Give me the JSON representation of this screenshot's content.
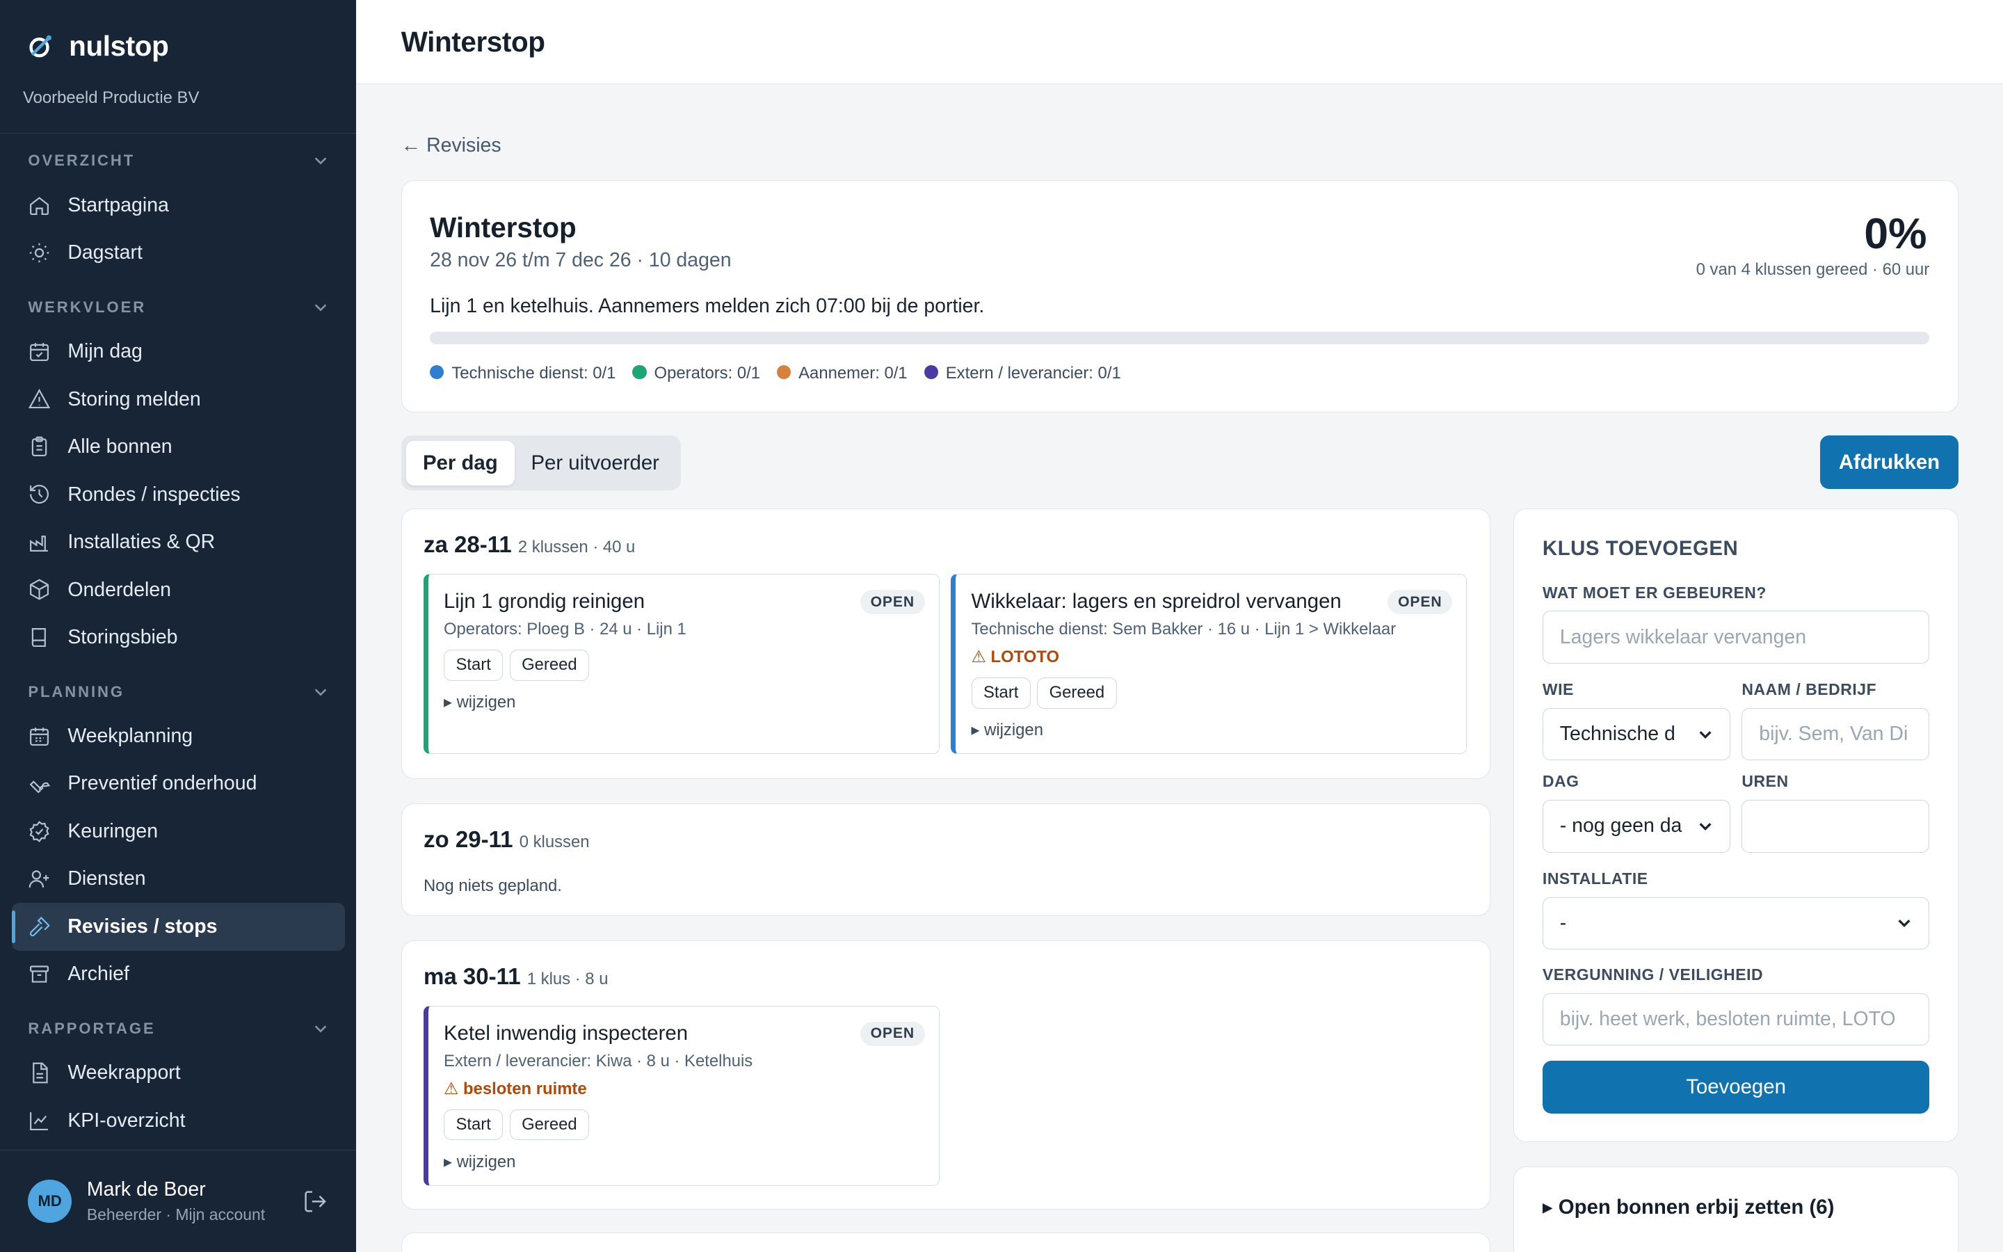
{
  "brand": {
    "name": "nulstop",
    "org": "Voorbeeld Productie BV"
  },
  "sidebar": {
    "sections": [
      {
        "title": "OVERZICHT",
        "items": [
          {
            "label": "Startpagina",
            "icon": "home-icon"
          },
          {
            "label": "Dagstart",
            "icon": "sun-icon"
          }
        ]
      },
      {
        "title": "WERKVLOER",
        "items": [
          {
            "label": "Mijn dag",
            "icon": "calendar-check-icon"
          },
          {
            "label": "Storing melden",
            "icon": "warning-icon"
          },
          {
            "label": "Alle bonnen",
            "icon": "clipboard-icon"
          },
          {
            "label": "Rondes / inspecties",
            "icon": "history-icon"
          },
          {
            "label": "Installaties & QR",
            "icon": "factory-icon"
          },
          {
            "label": "Onderdelen",
            "icon": "box-icon"
          },
          {
            "label": "Storingsbieb",
            "icon": "book-icon"
          }
        ]
      },
      {
        "title": "PLANNING",
        "items": [
          {
            "label": "Weekplanning",
            "icon": "calendar-icon"
          },
          {
            "label": "Preventief onderhoud",
            "icon": "wrench-icon"
          },
          {
            "label": "Keuringen",
            "icon": "badge-check-icon"
          },
          {
            "label": "Diensten",
            "icon": "user-plus-icon"
          },
          {
            "label": "Revisies / stops",
            "icon": "hammer-icon",
            "active": true
          },
          {
            "label": "Archief",
            "icon": "archive-icon"
          }
        ]
      },
      {
        "title": "RAPPORTAGE",
        "items": [
          {
            "label": "Weekrapport",
            "icon": "file-text-icon"
          },
          {
            "label": "KPI-overzicht",
            "icon": "line-chart-icon"
          }
        ]
      }
    ]
  },
  "user": {
    "initials": "MD",
    "name": "Mark de Boer",
    "role": "Beheerder · Mijn account"
  },
  "header": {
    "title": "Winterstop"
  },
  "back_link": "← Revisies",
  "summary": {
    "title": "Winterstop",
    "dates": "28 nov 26 t/m 7 dec 26 · 10 dagen",
    "description": "Lijn 1 en ketelhuis. Aannemers melden zich 07:00 bij de portier.",
    "percent": "0%",
    "progress_fraction": 0,
    "progress_text": "0 van 4 klussen gereed · 60 uur",
    "legend": [
      {
        "label": "Technische dienst: 0/1",
        "color": "#2f7fd1"
      },
      {
        "label": "Operators: 0/1",
        "color": "#1ba672"
      },
      {
        "label": "Aannemer: 0/1",
        "color": "#d6813e"
      },
      {
        "label": "Extern / leverancier: 0/1",
        "color": "#4a3aa6"
      }
    ]
  },
  "tabs": {
    "per_day": "Per dag",
    "per_executor": "Per uitvoerder"
  },
  "print_label": "Afdrukken",
  "days": [
    {
      "label": "za 28-11",
      "meta": "2 klussen · 40 u",
      "jobs": [
        {
          "title": "Lijn 1 grondig reinigen",
          "meta": "Operators: Ploeg B · 24 u · Lijn 1",
          "status": "OPEN",
          "color": "#1ba672"
        },
        {
          "title": "Wikkelaar: lagers en spreidrol vervangen",
          "meta": "Technische dienst: Sem Bakker · 16 u · Lijn 1 > Wikkelaar",
          "warn": "⚠ LOTOTO",
          "status": "OPEN",
          "color": "#2f7fd1"
        }
      ]
    },
    {
      "label": "zo 29-11",
      "meta": "0 klussen",
      "empty": "Nog niets gepland."
    },
    {
      "label": "ma 30-11",
      "meta": "1 klus · 8 u",
      "jobs": [
        {
          "title": "Ketel inwendig inspecteren",
          "meta": "Extern / leverancier: Kiwa · 8 u · Ketelhuis",
          "warn": "⚠ besloten ruimte",
          "status": "OPEN",
          "color": "#4a3aa6"
        }
      ]
    }
  ],
  "job_buttons": {
    "start": "Start",
    "done": "Gereed",
    "edit": "▸ wijzigen"
  },
  "add_form": {
    "title": "KLUS TOEVOEGEN",
    "what_label": "WAT MOET ER GEBEUREN?",
    "what_placeholder": "Lagers wikkelaar vervangen",
    "who_label": "WIE",
    "who_value": "Technische d",
    "name_label": "NAAM / BEDRIJF",
    "name_placeholder": "bijv. Sem, Van Di",
    "day_label": "DAG",
    "day_value": "- nog geen da",
    "hours_label": "UREN",
    "hours_value": "",
    "install_label": "INSTALLATIE",
    "install_value": "-",
    "permit_label": "VERGUNNING / VEILIGHEID",
    "permit_placeholder": "bijv. heet werk, besloten ruimte, LOTO",
    "submit": "Toevoegen"
  },
  "open_bonnen": "▸ Open bonnen erbij zetten (6)"
}
